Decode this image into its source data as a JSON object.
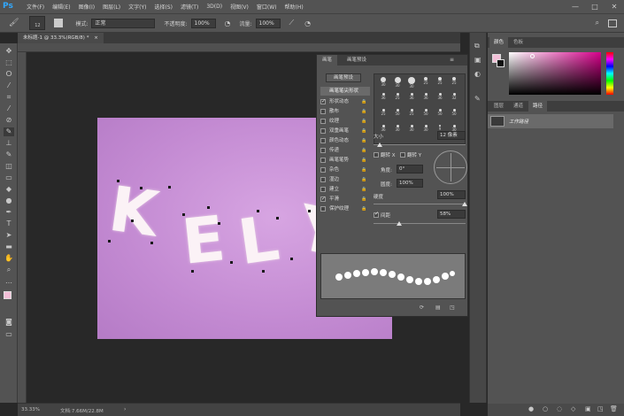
{
  "app": {
    "logo": "Ps"
  },
  "menubar": {
    "items": [
      "文件(F)",
      "编辑(E)",
      "图像(I)",
      "图层(L)",
      "文字(Y)",
      "选择(S)",
      "滤镜(T)",
      "3D(D)",
      "视图(V)",
      "窗口(W)",
      "帮助(H)"
    ],
    "minimize": "—",
    "maximize": "□",
    "close": "✕"
  },
  "options_bar": {
    "brush_size": "12",
    "mode_label": "模式:",
    "mode_value": "正常",
    "opacity_label": "不透明度:",
    "opacity_value": "100%",
    "flow_label": "流量:",
    "flow_value": "100%"
  },
  "document": {
    "tab_title": "未标题-1 @ 33.3%(RGB/8) *",
    "tab_close": "×",
    "text": [
      "K",
      "E",
      "L",
      "Y"
    ],
    "canvas_color": "#c98fd6"
  },
  "status": {
    "zoom": "33.33%",
    "doc_info": "文档:7.66M/22.8M"
  },
  "brush_panel": {
    "tabs": [
      "画笔",
      "画笔预设"
    ],
    "preset_button": "画笔预设",
    "tip_shape_label": "画笔笔尖形状",
    "options": [
      {
        "label": "形状动态",
        "checked": true
      },
      {
        "label": "散布",
        "checked": false
      },
      {
        "label": "纹理",
        "checked": false
      },
      {
        "label": "双重画笔",
        "checked": false
      },
      {
        "label": "颜色动态",
        "checked": false
      },
      {
        "label": "传递",
        "checked": false
      },
      {
        "label": "画笔笔势",
        "checked": false
      },
      {
        "label": "杂色",
        "checked": false
      },
      {
        "label": "湿边",
        "checked": false
      },
      {
        "label": "建立",
        "checked": false
      },
      {
        "label": "平滑",
        "checked": true
      },
      {
        "label": "保护纹理",
        "checked": false
      }
    ],
    "tip_sizes": [
      "30",
      "30",
      "30",
      "25",
      "25",
      "25",
      "36",
      "25",
      "36",
      "36",
      "36",
      "32",
      "25",
      "50",
      "25",
      "50",
      "50",
      "50",
      "36",
      "30",
      "30",
      "30",
      "9",
      "30"
    ],
    "size_label": "大小",
    "size_value": "12 像素",
    "flip_x": "翻转 X",
    "flip_y": "翻转 Y",
    "angle_label": "角度:",
    "angle_value": "0°",
    "roundness_label": "圆度:",
    "roundness_value": "100%",
    "hardness_label": "硬度",
    "hardness_value": "100%",
    "spacing_label": "间距",
    "spacing_checked": true,
    "spacing_value": "58%"
  },
  "right_panels": {
    "color_tabs": [
      "颜色",
      "色板"
    ],
    "layer_tabs": [
      "图层",
      "通道",
      "路径"
    ],
    "active_layer_tab": "路径",
    "path_item": "工作路径"
  },
  "colors": {
    "foreground": "#f2bfd7",
    "accent": "#31a8ff"
  }
}
